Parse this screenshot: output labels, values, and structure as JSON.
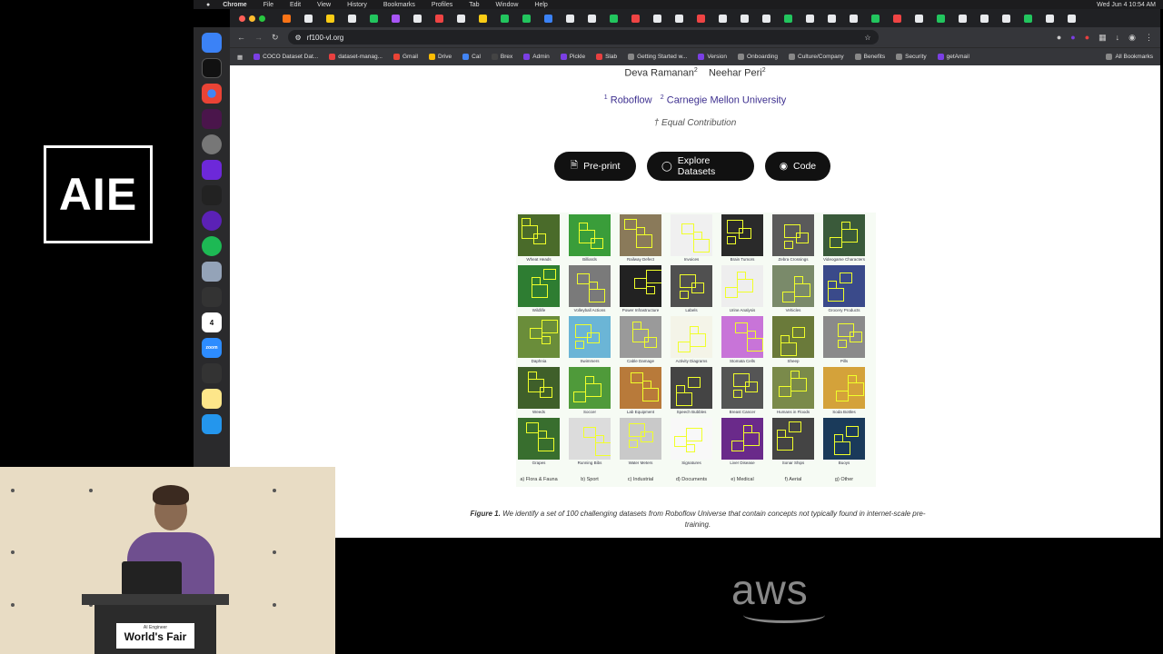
{
  "event": {
    "logo_text": "AIE",
    "podium_small": "AI Engineer",
    "podium_big": "World's Fair",
    "sponsor": "aws"
  },
  "menubar": {
    "items": [
      "Chrome",
      "File",
      "Edit",
      "View",
      "History",
      "Bookmarks",
      "Profiles",
      "Tab",
      "Window",
      "Help"
    ],
    "clock": "Wed Jun 4  10:54 AM"
  },
  "browser": {
    "url": "rf100-vl.org",
    "bookmarks": [
      {
        "label": "COCO Dataset Dat...",
        "color": "#7b3fe4"
      },
      {
        "label": "dataset-manag...",
        "color": "#e84040"
      },
      {
        "label": "Gmail",
        "color": "#ea4335"
      },
      {
        "label": "Drive",
        "color": "#fbbc04"
      },
      {
        "label": "Cal",
        "color": "#4285f4"
      },
      {
        "label": "Brex",
        "color": "#444444"
      },
      {
        "label": "Admin",
        "color": "#7b3fe4"
      },
      {
        "label": "Pickle",
        "color": "#7b3fe4"
      },
      {
        "label": "Slab",
        "color": "#e84040"
      },
      {
        "label": "Getting Started w...",
        "color": "#888888"
      },
      {
        "label": "Version",
        "color": "#7b3fe4"
      },
      {
        "label": "Onboarding",
        "color": "#888888"
      },
      {
        "label": "Culture/Company",
        "color": "#888888"
      },
      {
        "label": "Benefits",
        "color": "#888888"
      },
      {
        "label": "Security",
        "color": "#888888"
      },
      {
        "label": "getAmail",
        "color": "#7b3fe4"
      }
    ],
    "all_bookmarks": "All Bookmarks"
  },
  "page": {
    "authors": "Deva Ramanan",
    "authors_sup": "2",
    "authors2": "Neehar Peri",
    "authors2_sup": "2",
    "affil1_sup": "1",
    "affil1": "Roboflow",
    "affil2_sup": "2",
    "affil2": "Carnegie Mellon University",
    "equal": "† Equal Contribution",
    "buttons": {
      "preprint": "Pre-print",
      "explore": "Explore Datasets",
      "code": "Code"
    },
    "figure": {
      "columns": [
        {
          "category": "a) Flora & Fauna",
          "items": [
            "Wheat Heads",
            "Wildlife",
            "Daphnia",
            "Weeds",
            "Grapes"
          ]
        },
        {
          "category": "b) Sport",
          "items": [
            "Billiards",
            "Volleyball Actions",
            "Swimmers",
            "Soccer",
            "Running Bibs"
          ]
        },
        {
          "category": "c) Industrial",
          "items": [
            "Railway Defect",
            "Power Infrastructure",
            "Cable Damage",
            "Lab Equipment",
            "Water Meters"
          ]
        },
        {
          "category": "d) Documents",
          "items": [
            "Invoices",
            "Labels",
            "Activity Diagrams",
            "Speech Bubbles",
            "Signatures"
          ]
        },
        {
          "category": "e) Medical",
          "items": [
            "Brain Tumors",
            "Urine Analysis",
            "Stomata Cells",
            "Breast Cancer",
            "Liver Disease"
          ]
        },
        {
          "category": "f) Aerial",
          "items": [
            "Zebra Crossings",
            "Vehicles",
            "Sheep",
            "Humans in Floods",
            "Sonar Ships"
          ]
        },
        {
          "category": "g) Other",
          "items": [
            "Videogame Characters",
            "Grocery Products",
            "Pills",
            "Soda Bottles",
            "Buoys"
          ]
        }
      ],
      "caption_label": "Figure 1.",
      "caption_text": "We identify a set of 100 challenging datasets from Roboflow Universe that contain concepts not typically found in internet-scale pre-training."
    }
  }
}
